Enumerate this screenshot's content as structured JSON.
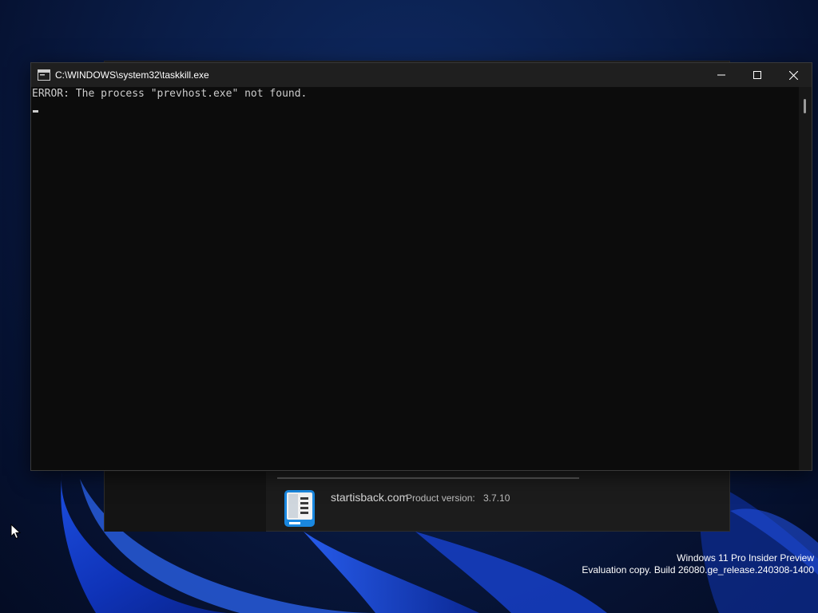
{
  "colors": {
    "accent": "#0078d4",
    "console_text": "#cccccc",
    "console_bg": "#0c0c0c",
    "titlebar_bg": "#1f1f1f"
  },
  "console": {
    "title": "C:\\WINDOWS\\system32\\taskkill.exe",
    "output_line": "ERROR: The process \"prevhost.exe\" not found.",
    "icons": {
      "app": "console-app-icon",
      "minimize": "minimize-icon",
      "maximize": "maximize-icon",
      "close": "close-icon"
    }
  },
  "startisback_dialog": {
    "site": "startisback.com",
    "version_label": "Product version:",
    "version_value": "3.7.10",
    "logo_icon": "startisback-logo-icon"
  },
  "watermark": {
    "line1": "Windows 11 Pro Insider Preview",
    "line2": "Evaluation copy. Build 26080.ge_release.240308-1400"
  },
  "pointer_icon": "mouse-pointer-icon"
}
